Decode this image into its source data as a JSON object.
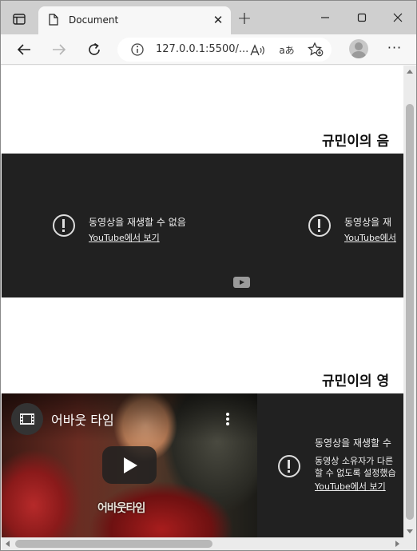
{
  "browser": {
    "tab_title": "Document",
    "tab_close_glyph": "✕",
    "new_tab_glyph": "+",
    "url": "127.0.0.1:5500/...",
    "read_aloud_glyph": "Ȃ",
    "translate_glyph": "aあ",
    "more_glyph": "···",
    "icons": [
      "tab-actions-icon",
      "page-icon",
      "close-icon",
      "plus-icon",
      "minimize-icon",
      "maximize-icon",
      "window-close-icon",
      "back-icon",
      "forward-icon",
      "refresh-icon",
      "info-icon",
      "read-aloud-icon",
      "translate-icon",
      "favorites-add-icon",
      "profile-icon",
      "more-icon"
    ]
  },
  "page": {
    "section1": {
      "heading": "규민이의 음",
      "videos": [
        {
          "message": "동영상을 재생할 수 없음",
          "link": "YouTube에서 보기"
        },
        {
          "message": "동영상을 재",
          "link": "YouTube에서"
        }
      ]
    },
    "section2": {
      "heading": "규민이의 영",
      "video_title": "어바웃 타임",
      "thumbnail_caption": "어바웃타임",
      "error": {
        "message": "동영상을 재생할 수",
        "detail_line1": "동영상 소유자가 다른",
        "detail_line2": "할 수 없도록 설정했습",
        "link": "YouTube에서 보기"
      }
    }
  },
  "colors": {
    "tabbar": "#cfcfcf",
    "toolbar": "#f7f7f7",
    "player_bg": "#212121",
    "page_bg": "#ffffff"
  }
}
